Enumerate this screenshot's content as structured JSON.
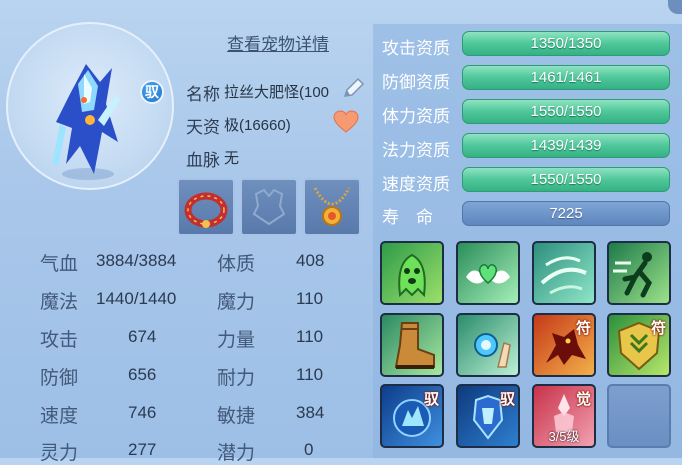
{
  "detail_link": "查看宠物详情",
  "pet_badge": "驭",
  "info": {
    "name_label": "名称",
    "name_value": "拉丝大肥怪(100",
    "talent_label": "天资",
    "talent_value": "极(16660)",
    "bloodline_label": "血脉",
    "bloodline_value": "无"
  },
  "stats": [
    {
      "l1": "气血",
      "v1": "3884/3884",
      "l2": "体质",
      "v2": "408"
    },
    {
      "l1": "魔法",
      "v1": "1440/1440",
      "l2": "魔力",
      "v2": "110"
    },
    {
      "l1": "攻击",
      "v1": "674",
      "l2": "力量",
      "v2": "110"
    },
    {
      "l1": "防御",
      "v1": "656",
      "l2": "耐力",
      "v2": "110"
    },
    {
      "l1": "速度",
      "v1": "746",
      "l2": "敏捷",
      "v2": "384"
    },
    {
      "l1": "灵力",
      "v1": "277",
      "l2": "潜力",
      "v2": "0"
    }
  ],
  "aptitudes": [
    {
      "label": "攻击资质",
      "value": "1350/1350",
      "fill": 1.0
    },
    {
      "label": "防御资质",
      "value": "1461/1461",
      "fill": 1.0
    },
    {
      "label": "体力资质",
      "value": "1550/1550",
      "fill": 1.0
    },
    {
      "label": "法力资质",
      "value": "1439/1439",
      "fill": 1.0
    },
    {
      "label": "速度资质",
      "value": "1550/1550",
      "fill": 1.0
    }
  ],
  "lifespan": {
    "label": "寿　命",
    "value": "7225"
  },
  "skills": {
    "tag_rein": "驭",
    "tag_charm": "符",
    "tag_awaken": "觉",
    "awaken_level": "3/5级"
  },
  "colors": {
    "bar_green": "#4fc79a",
    "bar_blue": "#6f95c8",
    "panel_bg": "#a9c7ea"
  }
}
